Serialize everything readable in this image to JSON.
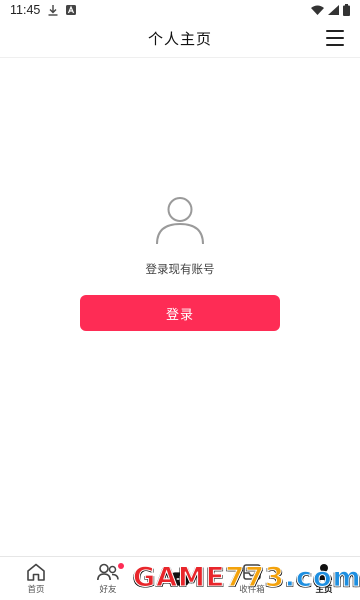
{
  "status_bar": {
    "time": "11:45",
    "left_icons": [
      "download-icon",
      "app-a-icon"
    ],
    "right_icons": [
      "wifi-icon",
      "signal-icon",
      "battery-icon"
    ]
  },
  "header": {
    "title": "个人主页",
    "menu_icon": "hamburger-menu-icon"
  },
  "main": {
    "avatar_icon": "user-avatar-icon",
    "hint": "登录现有账号",
    "login_button": "登录"
  },
  "bottom_nav": {
    "items": [
      {
        "label": "首页",
        "icon": "home-icon",
        "active": false,
        "badge": false
      },
      {
        "label": "好友",
        "icon": "friends-icon",
        "active": false,
        "badge": true
      },
      {
        "label": "",
        "icon": "add-icon",
        "active": false,
        "badge": false
      },
      {
        "label": "收件箱",
        "icon": "inbox-icon",
        "active": false,
        "badge": false
      },
      {
        "label": "主页",
        "icon": "profile-icon",
        "active": true,
        "badge": false
      }
    ]
  },
  "watermark": {
    "text_red": "GAME",
    "text_orange": "773",
    "text_blue": ".com"
  },
  "colors": {
    "accent": "#fe2c55",
    "text_primary": "#111111",
    "text_secondary": "#444444",
    "divider": "#efefef"
  }
}
